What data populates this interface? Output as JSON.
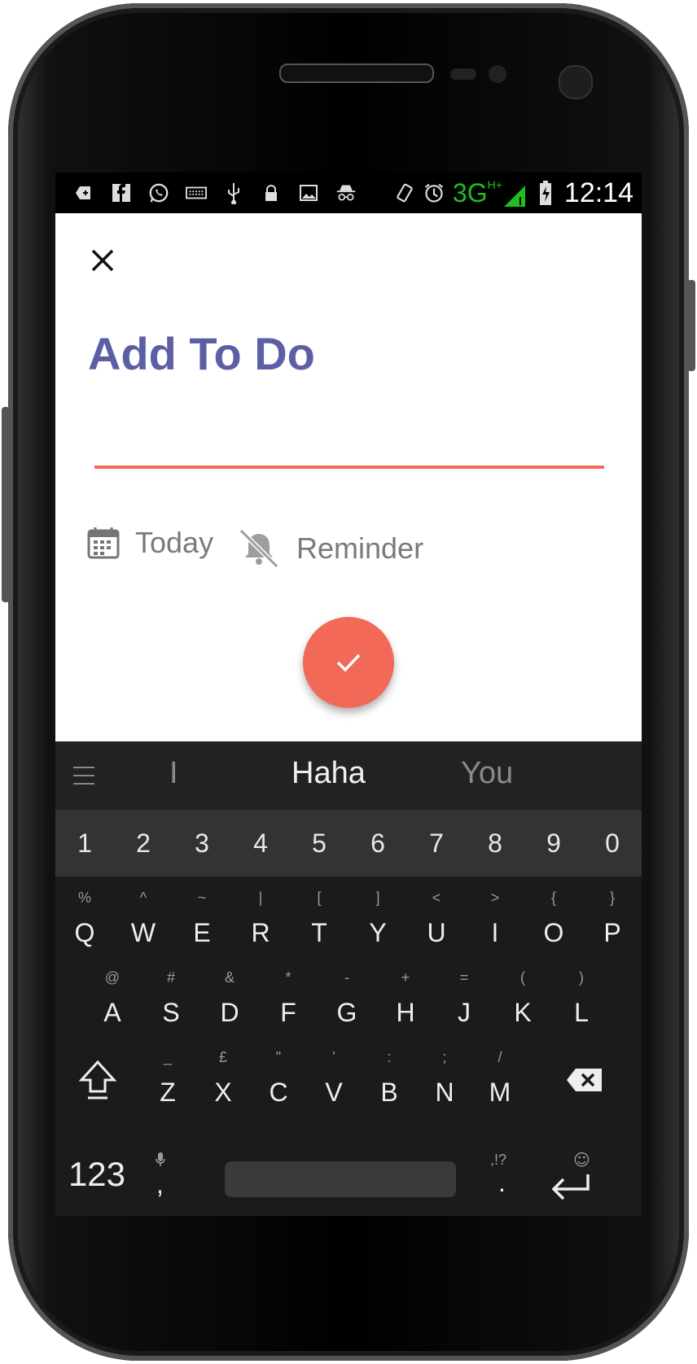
{
  "status_bar": {
    "time": "12:14",
    "network": "3G",
    "network_sup": "H+",
    "icons": [
      "notification-plus-icon",
      "facebook-icon",
      "whatsapp-icon",
      "keyboard-icon",
      "usb-icon",
      "lock-icon",
      "image-icon",
      "incognito-icon",
      "rotate-icon",
      "alarm-icon",
      "signal-icon",
      "battery-icon"
    ]
  },
  "app": {
    "title": "Add To Do",
    "input_placeholder": "",
    "date_label": "Today",
    "reminder_label": "Reminder",
    "accent_color": "#f26957",
    "title_color": "#5c5fa3"
  },
  "keyboard": {
    "suggestions": [
      "I",
      "Haha",
      "You"
    ],
    "number_row": [
      "1",
      "2",
      "3",
      "4",
      "5",
      "6",
      "7",
      "8",
      "9",
      "0"
    ],
    "row1": [
      {
        "main": "Q",
        "sub": "%"
      },
      {
        "main": "W",
        "sub": "^"
      },
      {
        "main": "E",
        "sub": "~"
      },
      {
        "main": "R",
        "sub": "|"
      },
      {
        "main": "T",
        "sub": "["
      },
      {
        "main": "Y",
        "sub": "]"
      },
      {
        "main": "U",
        "sub": "<"
      },
      {
        "main": "I",
        "sub": ">"
      },
      {
        "main": "O",
        "sub": "{"
      },
      {
        "main": "P",
        "sub": "}"
      }
    ],
    "row2": [
      {
        "main": "A",
        "sub": "@"
      },
      {
        "main": "S",
        "sub": "#"
      },
      {
        "main": "D",
        "sub": "&"
      },
      {
        "main": "F",
        "sub": "*"
      },
      {
        "main": "G",
        "sub": "-"
      },
      {
        "main": "H",
        "sub": "+"
      },
      {
        "main": "J",
        "sub": "="
      },
      {
        "main": "K",
        "sub": "("
      },
      {
        "main": "L",
        "sub": ")"
      }
    ],
    "row3": [
      {
        "main": "Z",
        "sub": "_"
      },
      {
        "main": "X",
        "sub": "£"
      },
      {
        "main": "C",
        "sub": "\""
      },
      {
        "main": "V",
        "sub": "'"
      },
      {
        "main": "B",
        "sub": ":"
      },
      {
        "main": "N",
        "sub": ";"
      },
      {
        "main": "M",
        "sub": "/"
      }
    ],
    "mode_key": "123",
    "comma_key": ",",
    "period_key": ".",
    "period_sub": ",!?"
  }
}
